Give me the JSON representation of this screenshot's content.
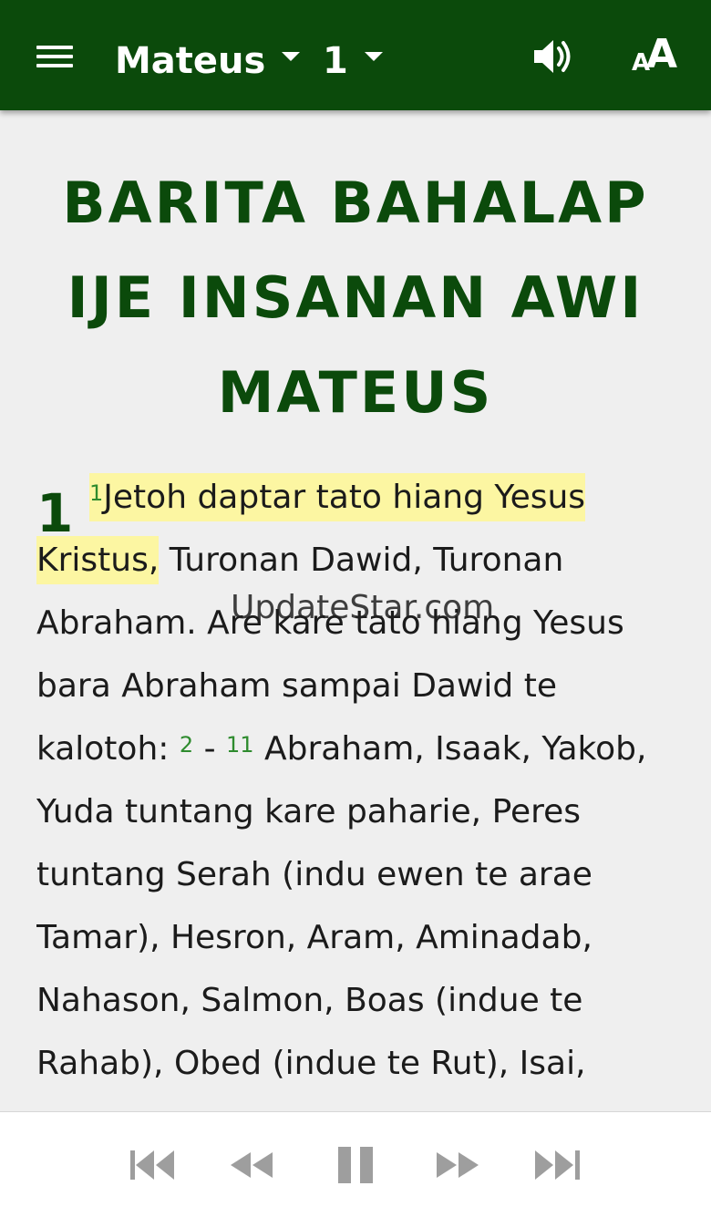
{
  "toolbar": {
    "book": "Mateus",
    "chapter": "1"
  },
  "content": {
    "title": "BARITA BAHALAP IJE INSANAN AWI MATEUS",
    "chapter_number": "1",
    "verse_1_num": "1",
    "verse_1_highlight": "Jetoh daptar tato hiang Yesus Kristus,",
    "verse_1_rest": " Turonan Dawid, Turonan Abraham. Are kare tato hiang Yesus bara Abraham sampai Dawid te kalotoh: ",
    "verse_2_num": "2",
    "verse_range_sep": " - ",
    "verse_11_num": "11",
    "verse_2_11_text": " Abraham, Isaak, Yakob, Yuda tuntang kare paharie, Peres tuntang Serah (indu ewen te arae Tamar), Hesron, Aram, Aminadab, Nahason, Salmon, Boas (indue te Rahab), Obed (indue te Rut), Isai,"
  },
  "watermark": "UpdateStar.com",
  "icons": {
    "menu": "menu-icon",
    "audio": "volume-icon",
    "text_size": "text-size-icon",
    "skip_back": "skip-previous-icon",
    "rewind": "rewind-icon",
    "pause": "pause-icon",
    "forward": "fast-forward-icon",
    "skip_next": "skip-next-icon"
  },
  "colors": {
    "appbar": "#0b4a0b",
    "title": "#0b4a0b",
    "verse_number": "#2e8b2e",
    "highlight": "#fcf6a2",
    "player_icons": "#9e9e9e"
  }
}
